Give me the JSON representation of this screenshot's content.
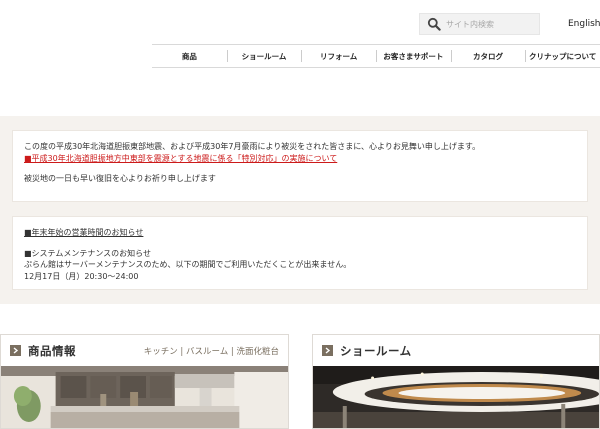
{
  "header": {
    "search": {
      "placeholder": "サイト内検索"
    },
    "language_link": "English"
  },
  "global_nav": {
    "items": [
      {
        "label": "商品"
      },
      {
        "label": "ショールーム"
      },
      {
        "label": "リフォーム"
      },
      {
        "label": "お客さまサポート"
      },
      {
        "label": "カタログ"
      },
      {
        "label": "クリナップについて"
      }
    ]
  },
  "notices": {
    "disaster": {
      "message": "この度の平成30年北海道胆振東部地震、および平成30年7月豪雨により被災をされた皆さまに、心よりお見舞い申し上げます。",
      "link": "■平成30年北海道胆振地方中東部を震源とする地震に係る「特別対応」の実施について",
      "closing": "被災地の一日も早い復旧を心よりお祈り申し上げます"
    },
    "maintenance": {
      "holiday_link": "■年末年始の営業時間のお知らせ",
      "heading": "■システムメンテナンスのお知らせ",
      "body": "ぷらん館はサーバーメンテナンスのため、以下の期間でご利用いただくことが出来ません。",
      "period": "12月17日（月）20:30～24:00"
    }
  },
  "cards": {
    "products": {
      "title": "商品情報",
      "subtitle": "キッチン | バスルーム | 洗面化粧台"
    },
    "showroom": {
      "title": "ショールーム"
    }
  },
  "colors": {
    "accent_brown": "#7a6f60",
    "notice_red": "#cc1a1a",
    "band_background": "#f5f2ee"
  }
}
